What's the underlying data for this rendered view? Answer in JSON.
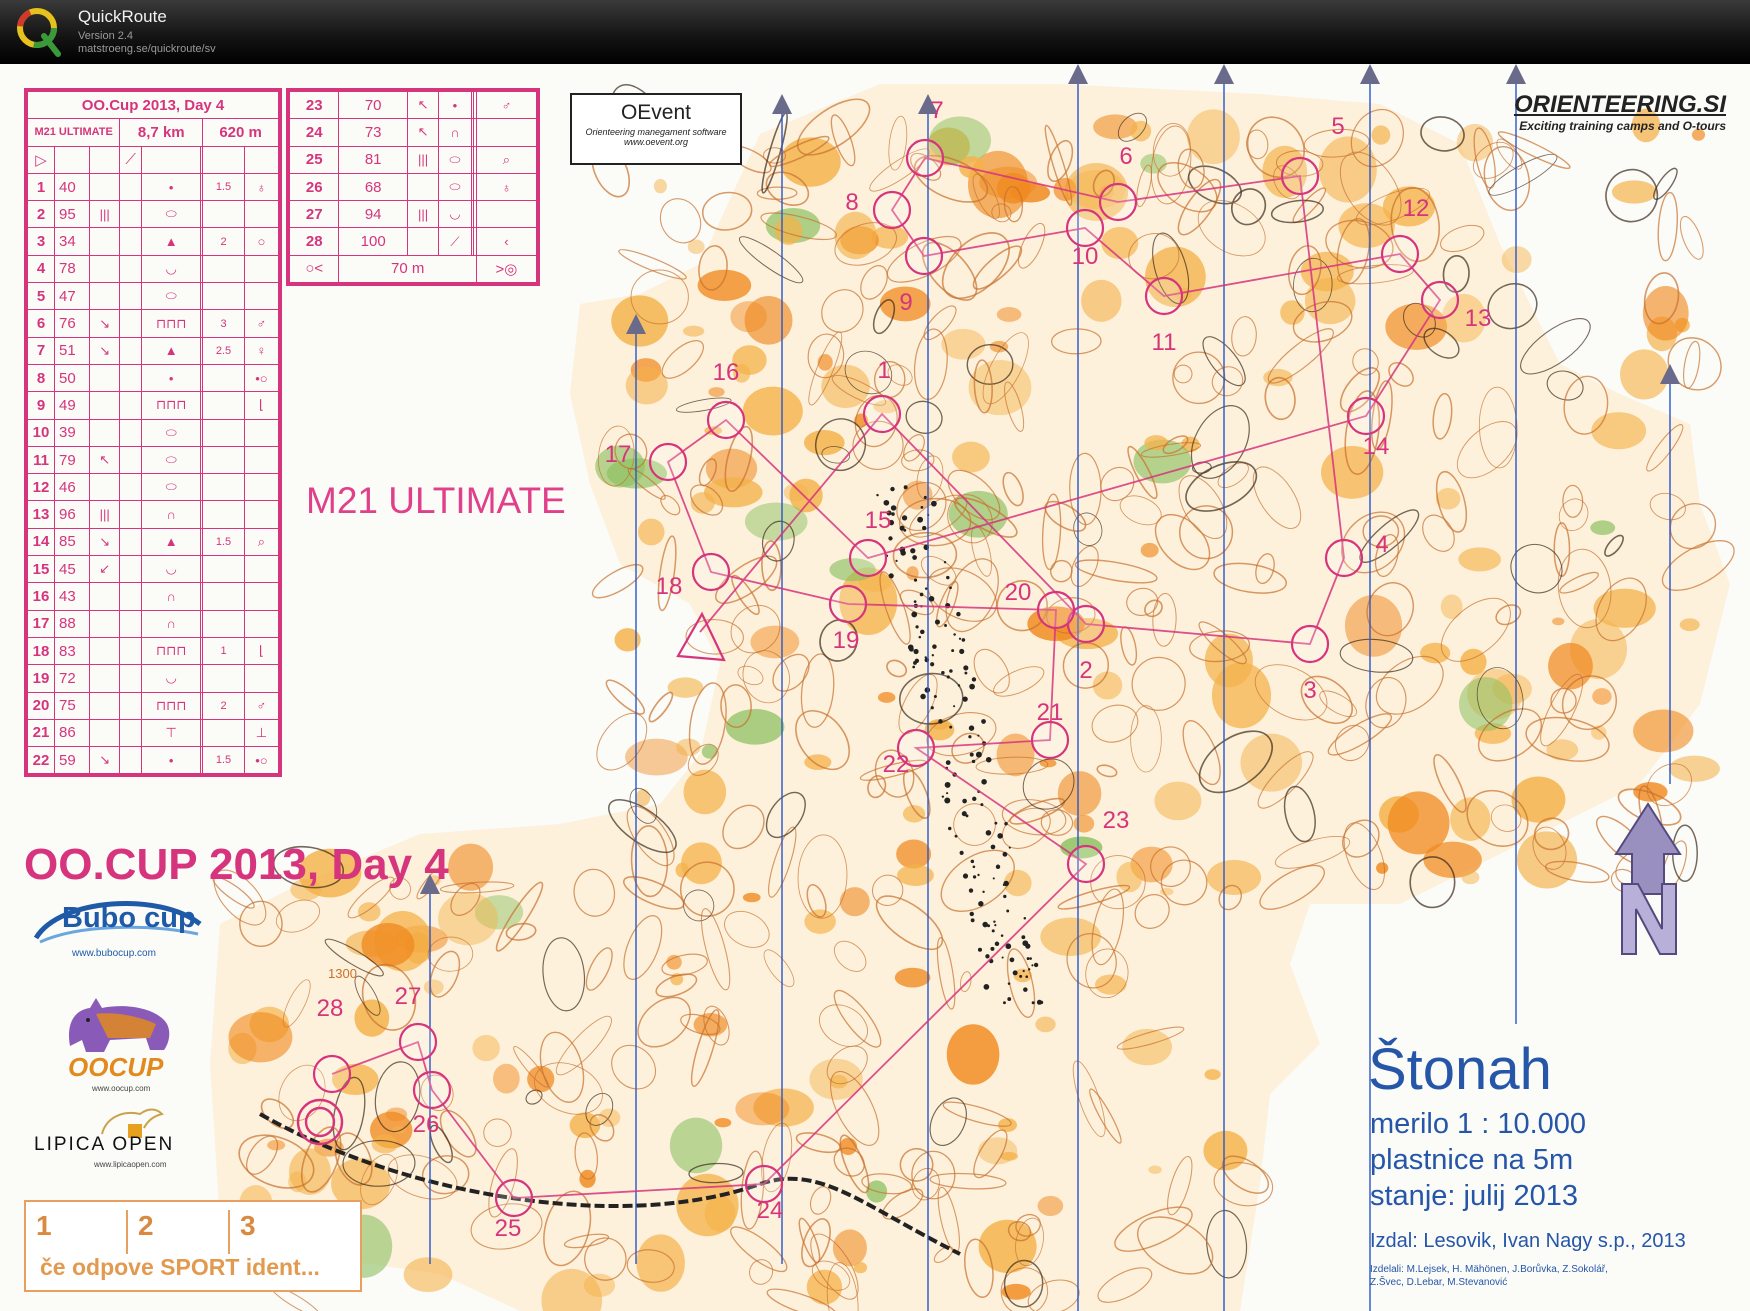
{
  "app": {
    "name": "QuickRoute",
    "version": "Version 2.4",
    "url": "matstroeng.se/quickroute/sv"
  },
  "course": {
    "event": "OO.Cup 2013, Day 4",
    "class": "M21 ULTIMATE",
    "length": "8,7 km",
    "climb": "620 m",
    "start_row_symbol": "▷",
    "controls_left": [
      {
        "n": "1",
        "code": "40",
        "dir": "",
        "feat": "•",
        "dim": "1.5",
        "pos": "♁"
      },
      {
        "n": "2",
        "code": "95",
        "dir": "|||",
        "feat": "⬭",
        "dim": "",
        "pos": ""
      },
      {
        "n": "3",
        "code": "34",
        "dir": "",
        "feat": "▲",
        "dim": "2",
        "pos": "○"
      },
      {
        "n": "4",
        "code": "78",
        "dir": "",
        "feat": "◡",
        "dim": "",
        "pos": ""
      },
      {
        "n": "5",
        "code": "47",
        "dir": "",
        "feat": "⬭",
        "dim": "",
        "pos": ""
      },
      {
        "n": "6",
        "code": "76",
        "dir": "↘",
        "feat": "⊓⊓⊓",
        "dim": "3",
        "pos": "♂"
      },
      {
        "n": "7",
        "code": "51",
        "dir": "↘",
        "feat": "▲",
        "dim": "2.5",
        "pos": "♀"
      },
      {
        "n": "8",
        "code": "50",
        "dir": "",
        "feat": "•",
        "dim": "",
        "pos": "•○"
      },
      {
        "n": "9",
        "code": "49",
        "dir": "",
        "feat": "⊓⊓⊓",
        "dim": "",
        "pos": "⌊"
      },
      {
        "n": "10",
        "code": "39",
        "dir": "",
        "feat": "⬭",
        "dim": "",
        "pos": ""
      },
      {
        "n": "11",
        "code": "79",
        "dir": "↖",
        "feat": "⬭",
        "dim": "",
        "pos": ""
      },
      {
        "n": "12",
        "code": "46",
        "dir": "",
        "feat": "⬭",
        "dim": "",
        "pos": ""
      },
      {
        "n": "13",
        "code": "96",
        "dir": "|||",
        "feat": "∩",
        "dim": "",
        "pos": ""
      },
      {
        "n": "14",
        "code": "85",
        "dir": "↘",
        "feat": "▲",
        "dim": "1.5",
        "pos": "⌕"
      },
      {
        "n": "15",
        "code": "45",
        "dir": "↙",
        "feat": "◡",
        "dim": "",
        "pos": ""
      },
      {
        "n": "16",
        "code": "43",
        "dir": "",
        "feat": "∩",
        "dim": "",
        "pos": ""
      },
      {
        "n": "17",
        "code": "88",
        "dir": "",
        "feat": "∩",
        "dim": "",
        "pos": ""
      },
      {
        "n": "18",
        "code": "83",
        "dir": "",
        "feat": "⊓⊓⊓",
        "dim": "1",
        "pos": "⌊"
      },
      {
        "n": "19",
        "code": "72",
        "dir": "",
        "feat": "◡",
        "dim": "",
        "pos": ""
      },
      {
        "n": "20",
        "code": "75",
        "dir": "",
        "feat": "⊓⊓⊓",
        "dim": "2",
        "pos": "♂"
      },
      {
        "n": "21",
        "code": "86",
        "dir": "",
        "feat": "⊤",
        "dim": "",
        "pos": "⊥"
      },
      {
        "n": "22",
        "code": "59",
        "dir": "↘",
        "feat": "•",
        "dim": "1.5",
        "pos": "•○"
      }
    ],
    "controls_right": [
      {
        "n": "23",
        "code": "70",
        "dir": "↖",
        "feat": "•",
        "pos": "♂"
      },
      {
        "n": "24",
        "code": "73",
        "dir": "↖",
        "feat": "∩",
        "pos": ""
      },
      {
        "n": "25",
        "code": "81",
        "dir": "|||",
        "feat": "⬭",
        "pos": "⌕"
      },
      {
        "n": "26",
        "code": "68",
        "dir": "",
        "feat": "⬭",
        "pos": "♁"
      },
      {
        "n": "27",
        "code": "94",
        "dir": "|||",
        "feat": "◡",
        "pos": ""
      },
      {
        "n": "28",
        "code": "100",
        "dir": "",
        "feat": "⟋",
        "pos": "‹"
      }
    ],
    "finish_distance": "70 m",
    "big_title": "OO.CUP 2013, Day 4"
  },
  "logos": {
    "oevent_title": "OEvent",
    "oevent_sub": "Orienteering manegament software",
    "oevent_url": "www.oevent.org",
    "orienteering_si": "ORIENTEERING.SI",
    "orienteering_si_tag": "Exciting training camps and O-tours",
    "bubo": "Bubo cup",
    "bubo_url": "www.bubocup.com",
    "oocup": "OOCUP",
    "oocup_url": "www.oocup.com",
    "lipica": "LIPICA OPEN",
    "lipica_url": "www.lipicaopen.com"
  },
  "backup_box": {
    "c1": "1",
    "c2": "2",
    "c3": "3",
    "message": "če odpove SPORT ident..."
  },
  "map_info": {
    "name": "Štonah",
    "scale": "merilo 1 : 10.000",
    "contours": "plastnice na 5m",
    "status": "stanje: julij 2013",
    "publisher": "Izdal: Lesovik, Ivan Nagy s.p., 2013",
    "credits1": "Izdelali: M.Lejsek, H. Mähönen, J.Borůvka, Z.Sokolář,",
    "credits2": "Z.Švec, D.Lebar, M.Stevanović",
    "contour_label": "1300"
  },
  "map_controls": [
    {
      "label": "1"
    },
    {
      "label": "2"
    },
    {
      "label": "3"
    },
    {
      "label": "4"
    },
    {
      "label": "5"
    },
    {
      "label": "6"
    },
    {
      "label": "7"
    },
    {
      "label": "8"
    },
    {
      "label": "9"
    },
    {
      "label": "10"
    },
    {
      "label": "11"
    },
    {
      "label": "12"
    },
    {
      "label": "13"
    },
    {
      "label": "14"
    },
    {
      "label": "15"
    },
    {
      "label": "16"
    },
    {
      "label": "17"
    },
    {
      "label": "18"
    },
    {
      "label": "19"
    },
    {
      "label": "20"
    },
    {
      "label": "21"
    },
    {
      "label": "22"
    },
    {
      "label": "23"
    },
    {
      "label": "24"
    },
    {
      "label": "25"
    },
    {
      "label": "26"
    },
    {
      "label": "27"
    },
    {
      "label": "28"
    }
  ],
  "colors": {
    "course": "#d6347c",
    "contour": "#c8702c",
    "open_land": "#f4b24a",
    "dense_open": "#f08a20",
    "green": "#8cc060",
    "north_lines": "#2a56c8"
  }
}
